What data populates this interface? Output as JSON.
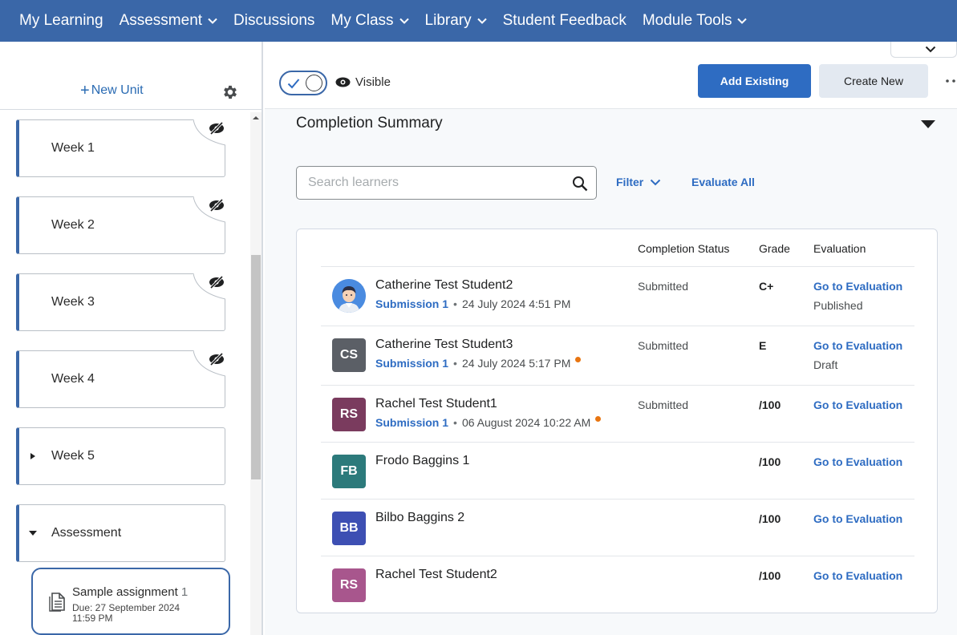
{
  "nav": {
    "items": [
      {
        "label": "My Learning",
        "has_dropdown": false
      },
      {
        "label": "Assessment",
        "has_dropdown": true
      },
      {
        "label": "Discussions",
        "has_dropdown": false
      },
      {
        "label": "My Class",
        "has_dropdown": true
      },
      {
        "label": "Library",
        "has_dropdown": true
      },
      {
        "label": "Student Feedback",
        "has_dropdown": false
      },
      {
        "label": "Module Tools",
        "has_dropdown": true
      }
    ]
  },
  "sidebar": {
    "new_unit_label": "New Unit",
    "units": [
      {
        "label": "Week 1",
        "hidden": true
      },
      {
        "label": "Week 2",
        "hidden": true
      },
      {
        "label": "Week 3",
        "hidden": true
      },
      {
        "label": "Week 4",
        "hidden": true
      },
      {
        "label": "Week 5",
        "expandable": "collapsed"
      },
      {
        "label": "Assessment",
        "expandable": "expanded"
      }
    ],
    "assignment": {
      "title": "Sample assignment",
      "number": "1",
      "due": "Due: 27 September 2024 11:59 PM"
    }
  },
  "toolbar": {
    "visibility_label": "Visible",
    "visibility_on": true,
    "add_existing_label": "Add Existing",
    "create_new_label": "Create New"
  },
  "summary": {
    "title": "Completion Summary",
    "search_placeholder": "Search learners",
    "filter_label": "Filter",
    "evaluate_all_label": "Evaluate All",
    "columns": {
      "status": "Completion Status",
      "grade": "Grade",
      "evaluation": "Evaluation"
    },
    "rows": [
      {
        "name": "Catherine Test Student2",
        "avatar": "photo",
        "initials": "",
        "avatar_color": "#4a8be0",
        "submission": "Submission 1",
        "date": "24 July 2024 4:51 PM",
        "new_flag": false,
        "status": "Submitted",
        "grade": "C+",
        "eval_link": "Go to Evaluation",
        "eval_state": "Published"
      },
      {
        "name": "Catherine Test Student3",
        "avatar": "initials",
        "initials": "CS",
        "avatar_color": "#5b5f66",
        "submission": "Submission 1",
        "date": "24 July 2024 5:17 PM",
        "new_flag": true,
        "status": "Submitted",
        "grade": "E",
        "eval_link": "Go to Evaluation",
        "eval_state": "Draft"
      },
      {
        "name": "Rachel Test Student1",
        "avatar": "initials",
        "initials": "RS",
        "avatar_color": "#7a3b5e",
        "submission": "Submission 1",
        "date": "06 August 2024 10:22 AM",
        "new_flag": true,
        "status": "Submitted",
        "grade": "/100",
        "eval_link": "Go to Evaluation",
        "eval_state": ""
      },
      {
        "name": "Frodo Baggins 1",
        "avatar": "initials",
        "initials": "FB",
        "avatar_color": "#2c7a7b",
        "submission": "",
        "date": "",
        "new_flag": false,
        "status": "",
        "grade": "/100",
        "eval_link": "Go to Evaluation",
        "eval_state": ""
      },
      {
        "name": "Bilbo Baggins 2",
        "avatar": "initials",
        "initials": "BB",
        "avatar_color": "#3d4fb3",
        "submission": "",
        "date": "",
        "new_flag": false,
        "status": "",
        "grade": "/100",
        "eval_link": "Go to Evaluation",
        "eval_state": ""
      },
      {
        "name": "Rachel Test Student2",
        "avatar": "initials",
        "initials": "RS",
        "avatar_color": "#a8568d",
        "submission": "",
        "date": "",
        "new_flag": false,
        "status": "",
        "grade": "/100",
        "eval_link": "Go to Evaluation",
        "eval_state": ""
      }
    ]
  },
  "colors": {
    "nav_bg": "#3a67a8",
    "primary": "#2e6cc2",
    "accent_dot": "#e87511"
  }
}
